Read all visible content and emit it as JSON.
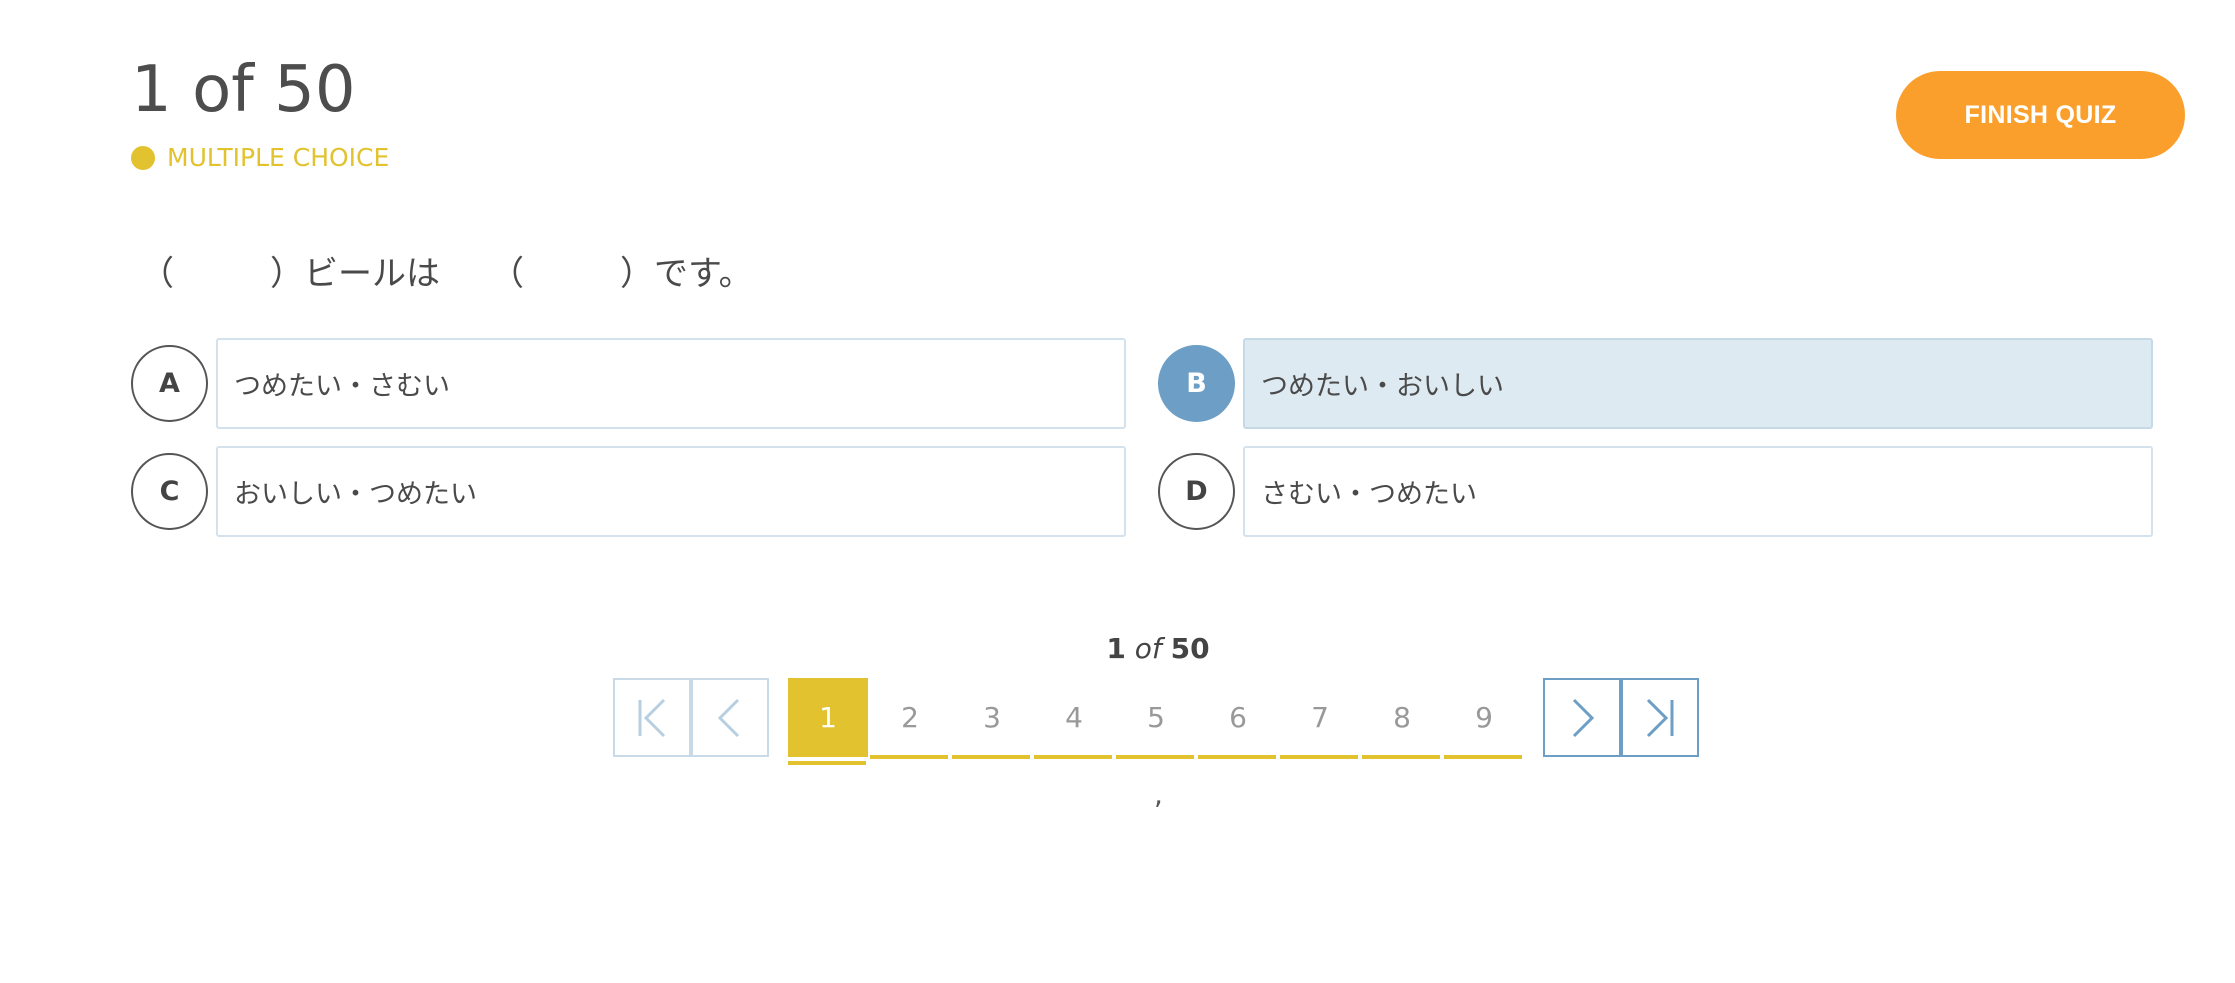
{
  "header": {
    "counter_title": "1 of 50",
    "question_type": "MULTIPLE CHOICE",
    "finish_label": "FINISH QUIZ"
  },
  "colors": {
    "accent_yellow": "#e2c22e",
    "finish_orange": "#fb9f2c",
    "selected_blue": "#6d9fc6",
    "selected_bg": "#deeaf2"
  },
  "question": {
    "open_paren_1": "（",
    "close_paren_1": "）",
    "middle_text": "ビールは",
    "open_paren_2": "（",
    "close_paren_2": "）",
    "end_text": "です。"
  },
  "options": [
    {
      "letter": "A",
      "text": "つめたい・さむい",
      "selected": false
    },
    {
      "letter": "B",
      "text": "つめたい・おいしい",
      "selected": true
    },
    {
      "letter": "C",
      "text": "おいしい・つめたい",
      "selected": false
    },
    {
      "letter": "D",
      "text": "さむい・つめたい",
      "selected": false
    }
  ],
  "pagination": {
    "current": "1",
    "of": "of",
    "total": "50",
    "pages": [
      "1",
      "2",
      "3",
      "4",
      "5",
      "6",
      "7",
      "8",
      "9"
    ],
    "icons": {
      "first": "first-page-icon",
      "prev": "chevron-left-icon",
      "next": "chevron-right-icon",
      "last": "last-page-icon"
    }
  },
  "footer_mark": ","
}
